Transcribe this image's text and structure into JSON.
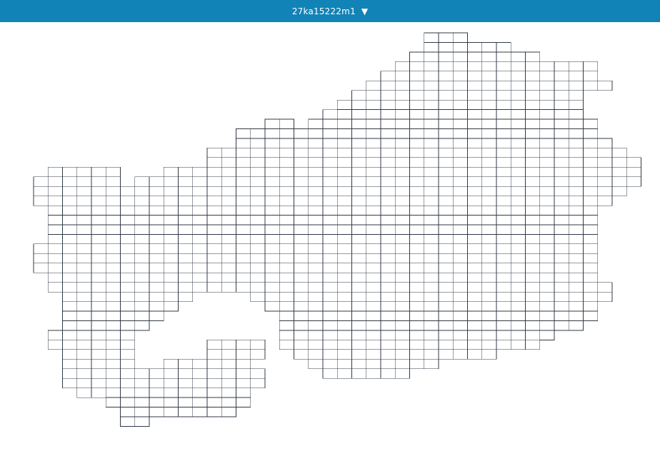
{
  "header": {
    "title": "27ka15222m1",
    "caret_glyph": "▼",
    "bg_color": "#1283b7",
    "text_color": "#ffffff"
  },
  "map": {
    "cell_stroke_color": "#303a44",
    "cell_fill_color": "#ffffff"
  }
}
